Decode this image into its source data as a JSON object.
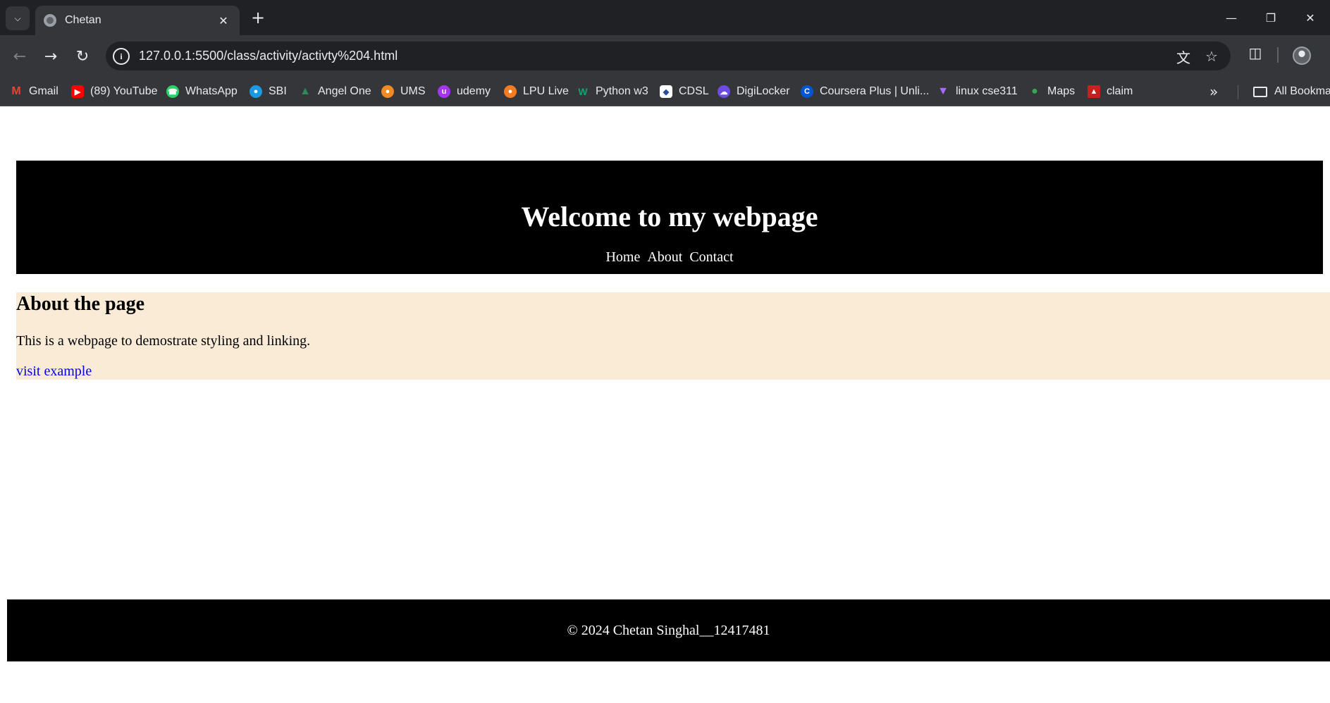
{
  "browser": {
    "tab_title": "Chetan",
    "url": "127.0.0.1:5500/class/activity/activty%204.html",
    "bookmarks": [
      {
        "label": "Gmail",
        "icon": "gmail-icon",
        "color": "#ea4335"
      },
      {
        "label": "(89) YouTube",
        "icon": "youtube-icon",
        "color": "#ff0000"
      },
      {
        "label": "WhatsApp",
        "icon": "whatsapp-icon",
        "color": "#25d366"
      },
      {
        "label": "SBI",
        "icon": "sbi-icon",
        "color": "#1a9ae0"
      },
      {
        "label": "Angel One",
        "icon": "angel-one-icon",
        "color": "#2e8b57"
      },
      {
        "label": "UMS",
        "icon": "ums-icon",
        "color": "#f08a24"
      },
      {
        "label": "udemy",
        "icon": "udemy-icon",
        "color": "#a435f0"
      },
      {
        "label": "LPU Live",
        "icon": "lpu-live-icon",
        "color": "#f47c20"
      },
      {
        "label": "Python w3",
        "icon": "w3schools-icon",
        "color": "#04aa6d"
      },
      {
        "label": "CDSL",
        "icon": "cdsl-icon",
        "color": "#2a4d9b"
      },
      {
        "label": "DigiLocker",
        "icon": "digilocker-icon",
        "color": "#6c4ce4"
      },
      {
        "label": "Coursera Plus | Unli...",
        "icon": "coursera-icon",
        "color": "#0056d2"
      },
      {
        "label": "linux cse311",
        "icon": "vite-icon",
        "color": "#a66bff"
      },
      {
        "label": "Maps",
        "icon": "maps-icon",
        "color": "#34a853"
      },
      {
        "label": "claim",
        "icon": "claim-icon",
        "color": "#c5221f"
      }
    ],
    "all_bookmarks_label": "All Bookmarks"
  },
  "page": {
    "header": {
      "title": "Welcome to my webpage",
      "nav": [
        "Home",
        "About",
        "Contact"
      ]
    },
    "about": {
      "heading": "About the page",
      "text": "This is a webpage to demostrate styling and linking.",
      "link": "visit example"
    },
    "footer": {
      "text": "© 2024 Chetan Singhal__12417481"
    }
  },
  "colors": {
    "header_bg": "#000000",
    "about_bg": "#faebd7",
    "link": "#0000ee"
  }
}
